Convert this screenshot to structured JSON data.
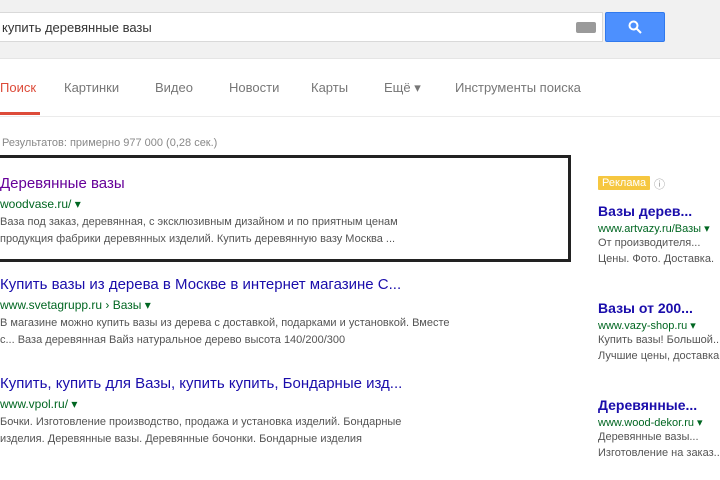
{
  "search": {
    "query": "купить деревянные вазы",
    "keyboard_icon": "keyboard-icon",
    "button_icon": "search-icon",
    "accent": "#4d90fe"
  },
  "nav": {
    "tabs": [
      {
        "label": "Поиск",
        "active": true
      },
      {
        "label": "Картинки",
        "active": false
      },
      {
        "label": "Видео",
        "active": false
      },
      {
        "label": "Новости",
        "active": false
      },
      {
        "label": "Карты",
        "active": false
      },
      {
        "label": "Ещё ▾",
        "active": false
      },
      {
        "label": "Инструменты поиска",
        "active": false
      }
    ],
    "active_color": "#dd4b39"
  },
  "stats": "Результатов: примерно 977 000 (0,28 сек.)",
  "results": [
    {
      "title": "Деревянные вазы",
      "url": "woodvase.ru/ ▾",
      "snippet": [
        "Ваза под заказ, деревянная, с эксклюзивным дизайном и по приятным ценам",
        "продукция фабрики деревянных изделий. Купить деревянную вазу Москва ..."
      ],
      "visited": true
    },
    {
      "title": "Купить вазы из дерева в Москве в интернет магазине С...",
      "url": "www.svetagrupp.ru › Вазы ▾",
      "snippet": [
        "В магазине можно купить вазы из дерева с доставкой, подарками и установкой. Вместе",
        "с... Ваза деревянная Вайз натуральное дерево высота 140/200/300"
      ],
      "visited": false
    },
    {
      "title": "Купить, купить для Вазы, купить купить, Бондарные изд...",
      "url": "www.vpol.ru/ ▾",
      "snippet": [
        "Бочки. Изготовление производство, продажа и установка изделий. Бондарные",
        "изделия. Деревянные вазы. Деревянные бочонки. Бондарные изделия"
      ],
      "visited": false
    }
  ],
  "ads": {
    "badge": "Реклама",
    "help": "ⓘ",
    "items": [
      {
        "title": "Вазы дерев...",
        "url": "www.artvazy.ru/Вазы ▾",
        "lines": [
          "От производителя...",
          "Цены. Фото. Доставка."
        ]
      },
      {
        "title": "Вазы от 200...",
        "url": "www.vazy-shop.ru ▾",
        "lines": [
          "Купить вазы! Большой...",
          "Лучшие цены, доставка..."
        ]
      },
      {
        "title": "Деревянные...",
        "url": "www.wood-dekor.ru ▾",
        "lines": [
          "Деревянные вазы...",
          "Изготовление на заказ..."
        ]
      }
    ]
  }
}
